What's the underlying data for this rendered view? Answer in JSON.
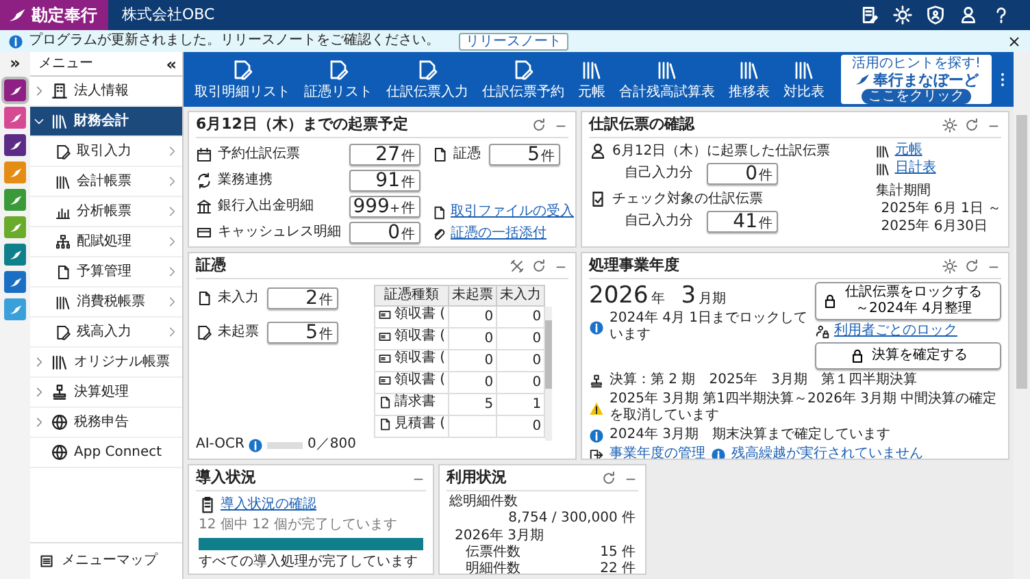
{
  "app": {
    "logo": "勘定奉行",
    "company": "株式会社OBC"
  },
  "notice": {
    "text": "プログラムが更新されました。リリースノートをご確認ください。",
    "button": "リリースノート"
  },
  "apps": [
    {
      "color": "#8e1f83",
      "selected": true
    },
    {
      "color": "#d54a93",
      "selected": false
    },
    {
      "color": "#5b2b86",
      "selected": false
    },
    {
      "color": "#e58c14",
      "selected": false
    },
    {
      "color": "#3a9a3a",
      "selected": false
    },
    {
      "color": "#6aab2c",
      "selected": false
    },
    {
      "color": "#0f7f8c",
      "selected": false
    },
    {
      "color": "#1b6fc2",
      "selected": false
    },
    {
      "color": "#3aa0d9",
      "selected": false
    }
  ],
  "menu": {
    "title": "メニュー",
    "expand_glyph": "»",
    "collapse_glyph": "«",
    "map": "メニューマップ",
    "items": [
      {
        "label": "法人情報",
        "kind": "group",
        "expanded": false,
        "selected": false
      },
      {
        "label": "財務会計",
        "kind": "group",
        "expanded": true,
        "selected": true,
        "children": [
          {
            "label": "取引入力"
          },
          {
            "label": "会計帳票"
          },
          {
            "label": "分析帳票"
          },
          {
            "label": "配賦処理"
          },
          {
            "label": "予算管理"
          },
          {
            "label": "消費税帳票"
          },
          {
            "label": "残高入力"
          }
        ]
      },
      {
        "label": "オリジナル帳票",
        "kind": "group",
        "expanded": false,
        "selected": false
      },
      {
        "label": "決算処理",
        "kind": "group",
        "expanded": false,
        "selected": false
      },
      {
        "label": "税務申告",
        "kind": "group",
        "expanded": false,
        "selected": false
      },
      {
        "label": "App Connect",
        "kind": "link",
        "selected": false
      }
    ]
  },
  "toolbar": {
    "items": [
      "取引明細リスト",
      "証憑リスト",
      "仕訳伝票入力",
      "仕訳伝票予約",
      "元帳",
      "合計残高試算表",
      "推移表",
      "対比表"
    ],
    "promo": {
      "caption": "活用のヒントを探す!",
      "title": "奉行まなぼーど",
      "button": "ここをクリック"
    }
  },
  "schedule": {
    "title": "6月12日（木）までの起票予定",
    "counts": [
      {
        "label": "予約仕訳伝票",
        "value": "27",
        "unit": "件"
      },
      {
        "label": "業務連携",
        "value": "91",
        "unit": "件"
      },
      {
        "label": "銀行入出金明細",
        "value": "999",
        "extra": "+",
        "unit": "件"
      },
      {
        "label": "キャッシュレス明細",
        "value": "0",
        "unit": "件"
      }
    ],
    "side": {
      "label": "証憑",
      "value": "5",
      "unit": "件"
    },
    "links": [
      "取引ファイルの受入",
      "証憑の一括添付"
    ]
  },
  "journal": {
    "title": "仕訳伝票の確認",
    "sections": [
      {
        "title": "6月12日（木）に起票した仕訳伝票",
        "sub": "自己入力分",
        "value": "0",
        "unit": "件"
      },
      {
        "title": "チェック対象の仕訳伝票",
        "sub": "自己入力分",
        "value": "41",
        "unit": "件"
      }
    ],
    "links": [
      "元帳",
      "日計表"
    ],
    "period_label": "集計期間",
    "period": [
      "2025年 6月 1日 ～",
      "2025年 6月30日"
    ]
  },
  "vouchers": {
    "title": "証憑",
    "counts": [
      {
        "label": "未入力",
        "value": "2",
        "unit": "件"
      },
      {
        "label": "未起票",
        "value": "5",
        "unit": "件"
      }
    ],
    "ocr": {
      "label": "AI-OCR",
      "level": 0,
      "reading": "0／800"
    },
    "columns": [
      "証憑種類",
      "未起票",
      "未入力"
    ],
    "rows": [
      {
        "type": "領収書 (",
        "unposted": "0",
        "unentered": "0"
      },
      {
        "type": "領収書 (",
        "unposted": "0",
        "unentered": "0"
      },
      {
        "type": "領収書 (",
        "unposted": "0",
        "unentered": "0"
      },
      {
        "type": "領収書 (",
        "unposted": "0",
        "unentered": "0"
      },
      {
        "type": "請求書",
        "unposted": "5",
        "unentered": "1"
      },
      {
        "type": "見積書 (",
        "unentered": "0"
      }
    ]
  },
  "fiscal": {
    "title": "処理事業年度",
    "year": "2026",
    "year_unit": "年",
    "month": "3",
    "month_unit": "月期",
    "lock_info": "2024年 4月 1日までロックしています",
    "lock_button": {
      "title": "仕訳伝票をロックする",
      "sub": "～2024年 4月整理"
    },
    "user_lock": "利用者ごとのロック",
    "settlement": "決算：第 2 期　2025年　3月期　第１四半期決算",
    "warning": "2025年 3月期 第1四半期決算～2026年 3月期 中間決算の確定を取消しています",
    "confirm_button": "決算を確定する",
    "confirmed": "2024年 3月期　期末決算まで確定しています",
    "links": [
      "事業年度の管理",
      "残高繰越が実行されていません"
    ]
  },
  "setup": {
    "title": "導入状況",
    "link": "導入状況の確認",
    "progress_text": "12 個中 12 個が完了しています",
    "level": 1,
    "done": "すべての導入処理が完了しています"
  },
  "usage": {
    "title": "利用状況",
    "total_label": "総明細件数",
    "total": "8,754 / 300,000 件",
    "period": "2026年 3月期",
    "rows": [
      {
        "label": "伝票件数",
        "value": "15 件"
      },
      {
        "label": "明細件数",
        "value": "22 件"
      }
    ]
  }
}
